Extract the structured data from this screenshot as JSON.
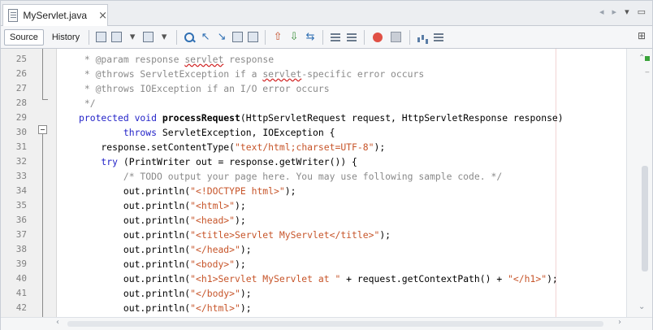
{
  "tab": {
    "title": "MyServlet.java",
    "close": "×"
  },
  "tab_nav": {
    "left": "◂",
    "right": "▸",
    "menu": "▾",
    "restore": "▭"
  },
  "toolbar": {
    "source_label": "Source",
    "history_label": "History",
    "right_glyph": "⊞"
  },
  "editor": {
    "line_numbers": [
      "25",
      "26",
      "27",
      "28",
      "29",
      "30",
      "31",
      "32",
      "33",
      "34",
      "35",
      "36",
      "37",
      "38",
      "39",
      "40",
      "41",
      "42"
    ],
    "lines": [
      [
        {
          "t": " * @param response ",
          "c": "cmt"
        },
        {
          "t": "servlet",
          "c": "cmt err"
        },
        {
          "t": " response",
          "c": "cmt"
        }
      ],
      [
        {
          "t": " * @throws ServletException if a ",
          "c": "cmt"
        },
        {
          "t": "servlet",
          "c": "cmt err"
        },
        {
          "t": "-specific error occurs",
          "c": "cmt"
        }
      ],
      [
        {
          "t": " * @throws IOException if an I/O error occurs",
          "c": "cmt"
        }
      ],
      [
        {
          "t": " */",
          "c": "cmt"
        }
      ],
      [
        {
          "t": "protected void ",
          "c": "kw"
        },
        {
          "t": "processRequest",
          "c": "bold"
        },
        {
          "t": "(HttpServletRequest request, HttpServletResponse response)",
          "c": ""
        }
      ],
      [
        {
          "t": "        throws ",
          "c": "kw"
        },
        {
          "t": "ServletException, IOException {",
          "c": ""
        }
      ],
      [
        {
          "t": "    response.setContentType(",
          "c": ""
        },
        {
          "t": "\"text/html;charset=UTF-8\"",
          "c": "str"
        },
        {
          "t": ");",
          "c": ""
        }
      ],
      [
        {
          "t": "    try ",
          "c": "kw"
        },
        {
          "t": "(PrintWriter out = response.getWriter()) {",
          "c": ""
        }
      ],
      [
        {
          "t": "        /* TODO output your page here. You may use following sample code. */",
          "c": "cmt"
        }
      ],
      [
        {
          "t": "        out.println(",
          "c": ""
        },
        {
          "t": "\"<!DOCTYPE html>\"",
          "c": "str"
        },
        {
          "t": ");",
          "c": ""
        }
      ],
      [
        {
          "t": "        out.println(",
          "c": ""
        },
        {
          "t": "\"<html>\"",
          "c": "str"
        },
        {
          "t": ");",
          "c": ""
        }
      ],
      [
        {
          "t": "        out.println(",
          "c": ""
        },
        {
          "t": "\"<head>\"",
          "c": "str"
        },
        {
          "t": ");",
          "c": ""
        }
      ],
      [
        {
          "t": "        out.println(",
          "c": ""
        },
        {
          "t": "\"<title>Servlet MyServlet</title>\"",
          "c": "str"
        },
        {
          "t": ");",
          "c": ""
        }
      ],
      [
        {
          "t": "        out.println(",
          "c": ""
        },
        {
          "t": "\"</head>\"",
          "c": "str"
        },
        {
          "t": ");",
          "c": ""
        }
      ],
      [
        {
          "t": "        out.println(",
          "c": ""
        },
        {
          "t": "\"<body>\"",
          "c": "str"
        },
        {
          "t": ");",
          "c": ""
        }
      ],
      [
        {
          "t": "        out.println(",
          "c": ""
        },
        {
          "t": "\"<h1>Servlet MyServlet at \"",
          "c": "str"
        },
        {
          "t": " + request.getContextPath() + ",
          "c": ""
        },
        {
          "t": "\"</h1>\"",
          "c": "str"
        },
        {
          "t": ");",
          "c": ""
        }
      ],
      [
        {
          "t": "        out.println(",
          "c": ""
        },
        {
          "t": "\"</body>\"",
          "c": "str"
        },
        {
          "t": ");",
          "c": ""
        }
      ],
      [
        {
          "t": "        out.println(",
          "c": ""
        },
        {
          "t": "\"</html>\"",
          "c": "str"
        },
        {
          "t": ");",
          "c": ""
        }
      ]
    ]
  },
  "colors": {
    "keyword": "#2323c8",
    "string": "#c7552a",
    "comment": "#8a8a8a",
    "gutter_bg": "#f0f0f0"
  },
  "icons": [
    "file-java-icon",
    "close-icon",
    "history-icon",
    "back-icon",
    "forward-icon",
    "find-icon",
    "find-prev-icon",
    "find-next-icon",
    "toggle-highlight-icon",
    "bookmark-icon",
    "prev-bookmark-icon",
    "next-bookmark-icon",
    "shift-left-icon",
    "shift-right-icon",
    "record-macro-icon",
    "stop-macro-icon",
    "comment-icon",
    "uncomment-icon",
    "split-icon"
  ]
}
